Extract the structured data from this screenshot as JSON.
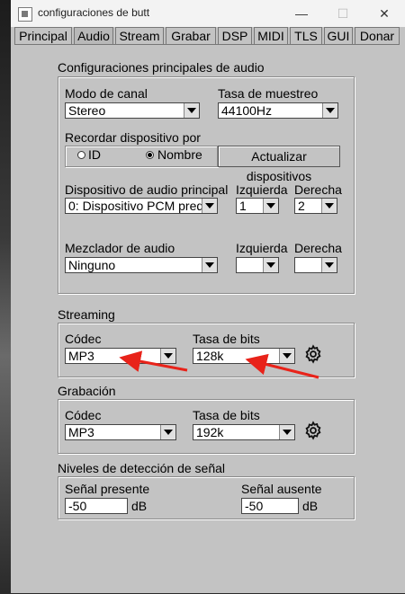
{
  "window": {
    "title": "configuraciones de butt",
    "min": "—",
    "max": "☐",
    "close": "✕"
  },
  "tabs": [
    "Principal",
    "Audio",
    "Stream",
    "Grabar",
    "DSP",
    "MIDI",
    "TLS",
    "GUI",
    "Donar"
  ],
  "main_audio": {
    "heading": "Configuraciones principales de audio",
    "channel_mode": {
      "label": "Modo de canal",
      "value": "Stereo"
    },
    "sample_rate": {
      "label": "Tasa de muestreo",
      "value": "44100Hz"
    },
    "remember": {
      "label": "Recordar dispositivo por",
      "option_id": "ID",
      "option_name": "Nombre",
      "selected": "Nombre"
    },
    "refresh_button": "Actualizar dispositivos",
    "main_device": {
      "label": "Dispositivo de audio principal",
      "value": "0: Dispositivo PCM pred"
    },
    "left": {
      "label": "Izquierda",
      "value": "1"
    },
    "right": {
      "label": "Derecha",
      "value": "2"
    },
    "mixer": {
      "label": "Mezclador de audio",
      "value": "Ninguno"
    },
    "mixer_left": {
      "label": "Izquierda",
      "value": ""
    },
    "mixer_right": {
      "label": "Derecha",
      "value": ""
    }
  },
  "streaming": {
    "heading": "Streaming",
    "codec": {
      "label": "Códec",
      "value": "MP3"
    },
    "bitrate": {
      "label": "Tasa de bits",
      "value": "128k"
    },
    "settings_icon": "gear-icon"
  },
  "recording": {
    "heading": "Grabación",
    "codec": {
      "label": "Códec",
      "value": "MP3"
    },
    "bitrate": {
      "label": "Tasa de bits",
      "value": "192k"
    },
    "settings_icon": "gear-icon"
  },
  "signal": {
    "heading": "Niveles de detección de señal",
    "present": {
      "label": "Señal presente",
      "value": "-50",
      "unit": "dB"
    },
    "absent": {
      "label": "Señal ausente",
      "value": "-50",
      "unit": "dB"
    }
  },
  "colors": {
    "annotation_arrow": "#e8231a",
    "window_bg": "#c3c3c3"
  }
}
